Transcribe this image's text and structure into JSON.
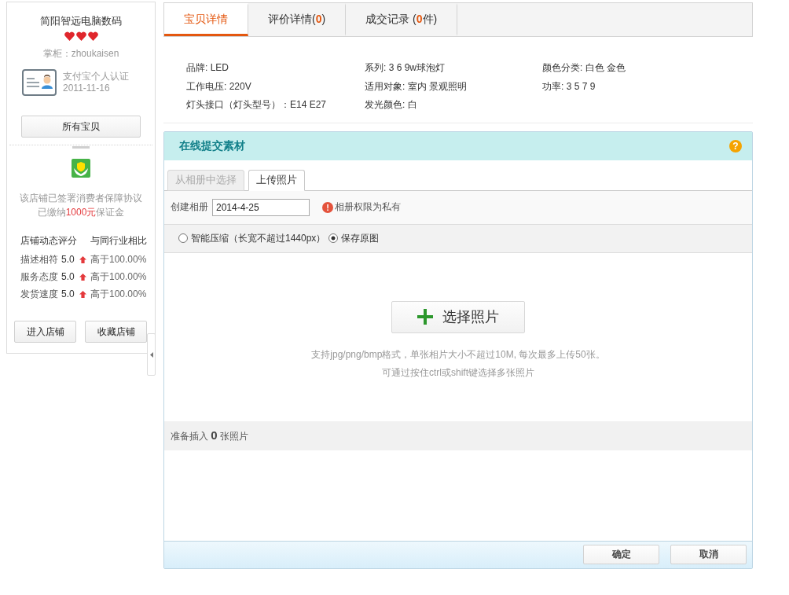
{
  "shop": {
    "name": "简阳智远电脑数码",
    "stars": 3,
    "owner": "掌柜：zhoukaisen",
    "certification": {
      "title": "支付宝个人认证",
      "date": "2011-11-16"
    },
    "all_items_button": "所有宝贝",
    "guarantee": [
      "该店铺已签署消费者保障协议",
      "已缴纳**1000元**保证金"
    ],
    "ratings": {
      "headers": [
        "店铺动态评分",
        "与同行业相比"
      ],
      "rows": [
        {
          "label": "描述相符",
          "score": "5.0",
          "higher": true,
          "comparison": "高于100.00%"
        },
        {
          "label": "服务态度",
          "score": "5.0",
          "higher": true,
          "comparison": "高于100.00%"
        },
        {
          "label": "发货速度",
          "score": "5.0",
          "higher": true,
          "comparison": "高于100.00%"
        }
      ]
    },
    "buttons": [
      "进入店铺",
      "收藏店铺"
    ]
  },
  "tabs": [
    {
      "label": "宝贝详情",
      "selected": true
    },
    {
      "label": "评价详情(**0**)",
      "selected": false
    },
    {
      "label": "成交记录 (**0**件)",
      "selected": false
    }
  ],
  "specs": [
    "品牌: LED",
    "系列: 3 6 9w球泡灯",
    "颜色分类: 白色 金色",
    "工作电压: 220V",
    "适用对象: 室内 景观照明",
    "功率: 3 5 7 9",
    "灯头接口（灯头型号）：E14 E27",
    "发光颜色: 白"
  ],
  "panel": {
    "title": "在线提交素材",
    "help_symbol": "?",
    "subtabs": [
      {
        "label": "从相册中选择",
        "selected": false
      },
      {
        "label": "上传照片",
        "selected": true
      }
    ],
    "album": {
      "label": "创建相册",
      "value": "2014-4-25",
      "alert_symbol": "!",
      "notice": "相册权限为私有"
    },
    "compression": [
      {
        "label": "智能压缩（长宽不超过1440px）",
        "selected": false
      },
      {
        "label": "保存原图",
        "selected": true
      }
    ],
    "upload_button": "选择照片",
    "hints": [
      "支持jpg/png/bmp格式，单张相片大小不超过10M, 每次最多上传50张。",
      "可通过按住ctrl或shift键选择多张照片"
    ],
    "ready_text": "准备插入 **0** 张照片",
    "actions": [
      "确定",
      "取消"
    ]
  }
}
